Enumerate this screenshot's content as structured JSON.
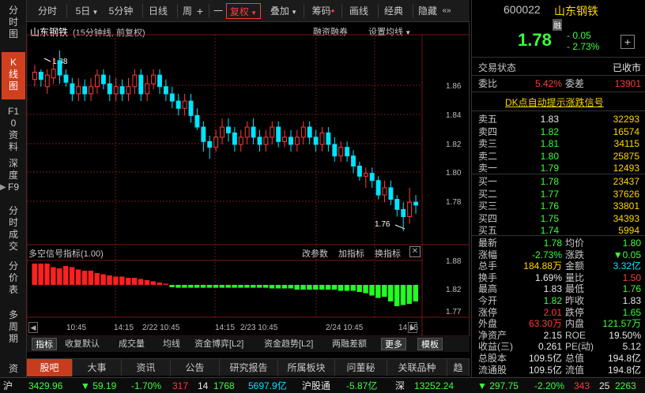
{
  "sidebar": {
    "items": [
      {
        "label": "分时图",
        "active": false
      },
      {
        "label": "K线图",
        "active": true
      },
      {
        "label": "F10资料",
        "active": false
      },
      {
        "label": "深度F9",
        "active": false
      },
      {
        "label": "分时成交",
        "active": false
      },
      {
        "label": "分价表",
        "active": false
      },
      {
        "label": "多周期",
        "active": false
      },
      {
        "label": "资",
        "active": false
      }
    ]
  },
  "toolbar": {
    "fenshi": "分时",
    "five_day": "5日",
    "five_min": "5分钟",
    "day": "日线",
    "week": "周",
    "plus": "+",
    "minus": "一",
    "fuquan": "复权",
    "diejia": "叠加",
    "choumai": "筹码",
    "huaxian": "画线",
    "jingdian": "经典",
    "yincang": "隐藏",
    "more": "«»"
  },
  "chart": {
    "stock_name": "山东钢铁",
    "subtitle": "(15分钟线, 前复权)",
    "rzrq": "融资融券",
    "set_ma": "设置均线",
    "high_label": "1.88",
    "low_label": "1.76",
    "price_ticks": [
      "1.86",
      "1.84",
      "1.82",
      "1.80",
      "1.78"
    ],
    "indicator_title": "多空信号指标",
    "indicator_param": "(1.00)",
    "ind_buttons": {
      "gaicanshu": "改参数",
      "jiazhibiao": "加指标",
      "huanzhibiao": "换指标"
    },
    "ind_ticks": [
      "1.88",
      "1.82",
      "1.77"
    ],
    "time_labels": [
      "10:45",
      "14:15",
      "2/22 10:45",
      "14:15",
      "2/23 10:45",
      "2/24 10:45",
      "14:15"
    ]
  },
  "chart_data": {
    "type": "candlestick",
    "ylim": [
      1.755,
      1.885
    ],
    "candles": [
      [
        1.865,
        1.87,
        1.875,
        1.86
      ],
      [
        1.87,
        1.865,
        1.872,
        1.86
      ],
      [
        1.86,
        1.868,
        1.872,
        1.855
      ],
      [
        1.866,
        1.872,
        1.88,
        1.862
      ],
      [
        1.878,
        1.868,
        1.885,
        1.862
      ],
      [
        1.868,
        1.863,
        1.872,
        1.86
      ],
      [
        1.862,
        1.855,
        1.866,
        1.85
      ],
      [
        1.855,
        1.86,
        1.866,
        1.85
      ],
      [
        1.86,
        1.855,
        1.865,
        1.85
      ],
      [
        1.855,
        1.86,
        1.866,
        1.85
      ],
      [
        1.86,
        1.868,
        1.872,
        1.855
      ],
      [
        1.868,
        1.862,
        1.872,
        1.858
      ],
      [
        1.862,
        1.855,
        1.868,
        1.85
      ],
      [
        1.855,
        1.86,
        1.866,
        1.85
      ],
      [
        1.86,
        1.855,
        1.865,
        1.85
      ],
      [
        1.855,
        1.86,
        1.866,
        1.85
      ],
      [
        1.86,
        1.868,
        1.872,
        1.855
      ],
      [
        1.868,
        1.855,
        1.872,
        1.85
      ],
      [
        1.855,
        1.862,
        1.868,
        1.85
      ],
      [
        1.862,
        1.868,
        1.872,
        1.858
      ],
      [
        1.868,
        1.86,
        1.872,
        1.855
      ],
      [
        1.86,
        1.855,
        1.865,
        1.85
      ],
      [
        1.855,
        1.85,
        1.86,
        1.845
      ],
      [
        1.85,
        1.845,
        1.855,
        1.84
      ],
      [
        1.845,
        1.85,
        1.855,
        1.84
      ],
      [
        1.85,
        1.84,
        1.855,
        1.835
      ],
      [
        1.84,
        1.832,
        1.845,
        1.83
      ],
      [
        1.832,
        1.822,
        1.836,
        1.815
      ],
      [
        1.822,
        1.818,
        1.826,
        1.81
      ],
      [
        1.818,
        1.825,
        1.83,
        1.815
      ],
      [
        1.825,
        1.832,
        1.838,
        1.82
      ],
      [
        1.832,
        1.828,
        1.838,
        1.822
      ],
      [
        1.828,
        1.82,
        1.832,
        1.815
      ],
      [
        1.82,
        1.825,
        1.83,
        1.815
      ],
      [
        1.825,
        1.832,
        1.836,
        1.82
      ],
      [
        1.832,
        1.825,
        1.838,
        1.82
      ],
      [
        1.825,
        1.82,
        1.83,
        1.815
      ],
      [
        1.82,
        1.825,
        1.83,
        1.815
      ],
      [
        1.825,
        1.832,
        1.836,
        1.82
      ],
      [
        1.832,
        1.822,
        1.836,
        1.818
      ],
      [
        1.822,
        1.825,
        1.83,
        1.818
      ],
      [
        1.825,
        1.82,
        1.83,
        1.815
      ],
      [
        1.82,
        1.825,
        1.83,
        1.815
      ],
      [
        1.825,
        1.832,
        1.836,
        1.82
      ],
      [
        1.832,
        1.825,
        1.836,
        1.82
      ],
      [
        1.825,
        1.82,
        1.83,
        1.815
      ],
      [
        1.82,
        1.828,
        1.832,
        1.815
      ],
      [
        1.828,
        1.82,
        1.832,
        1.815
      ],
      [
        1.82,
        1.812,
        1.825,
        1.808
      ],
      [
        1.812,
        1.818,
        1.822,
        1.808
      ],
      [
        1.818,
        1.812,
        1.822,
        1.808
      ],
      [
        1.812,
        1.805,
        1.816,
        1.8
      ],
      [
        1.805,
        1.798,
        1.808,
        1.795
      ],
      [
        1.798,
        1.8,
        1.804,
        1.79
      ],
      [
        1.8,
        1.795,
        1.804,
        1.79
      ],
      [
        1.795,
        1.785,
        1.798,
        1.782
      ],
      [
        1.785,
        1.79,
        1.795,
        1.78
      ],
      [
        1.79,
        1.782,
        1.795,
        1.778
      ],
      [
        1.782,
        1.775,
        1.785,
        1.77
      ],
      [
        1.775,
        1.77,
        1.78,
        1.76
      ],
      [
        1.77,
        1.78,
        1.79,
        1.765
      ],
      [
        1.78,
        1.778,
        1.785,
        1.772
      ]
    ],
    "indicator": [
      0.9,
      0.9,
      0.9,
      0.75,
      0.7,
      0.8,
      0.75,
      0.65,
      0.6,
      0.6,
      0.5,
      0.45,
      0.4,
      0.35,
      0.35,
      0.3,
      0.3,
      0.25,
      0.2,
      0.15,
      0.1,
      0.05,
      -0.1,
      -0.12,
      -0.12,
      -0.12,
      -0.12,
      -0.12,
      -0.12,
      -0.12,
      -0.12,
      -0.12,
      -0.12,
      -0.12,
      -0.12,
      -0.12,
      -0.12,
      -0.12,
      -0.15,
      -0.15,
      -0.15,
      -0.15,
      -0.2,
      -0.2,
      -0.2,
      -0.2,
      -0.2,
      -0.2,
      -0.2,
      -0.25,
      -0.25,
      -0.25,
      -0.3,
      -0.35,
      -0.45,
      -0.55,
      -0.5,
      -0.7,
      -0.9,
      -0.85,
      -0.8,
      -0.7
    ]
  },
  "ind_tabs": [
    "指标",
    "收复默认",
    "成交量",
    "均线",
    "资金博弈[L2]",
    "资金趋势[L2]",
    "两融差额",
    "更多",
    "模板"
  ],
  "nav_tabs": [
    "股吧",
    "大事",
    "资讯",
    "公告",
    "研究报告",
    "所属板块",
    "问董秘",
    "关联品种",
    "趋"
  ],
  "quote": {
    "code": "600022",
    "name": "山东钢铁",
    "rong": "融",
    "price": "1.78",
    "change": "- 0.05",
    "change_pct": "- 2.73%",
    "plus": "+",
    "status_label": "交易状态",
    "status_value": "已收市",
    "weibi_label": "委比",
    "weibi_value": "5.42%",
    "weicha_label": "委差",
    "weicha_value": "13901",
    "signal_link": "DK点自动提示涨跌信号",
    "asks": [
      {
        "label": "卖五",
        "price": "1.83",
        "vol": "32293"
      },
      {
        "label": "卖四",
        "price": "1.82",
        "vol": "16574"
      },
      {
        "label": "卖三",
        "price": "1.81",
        "vol": "34115"
      },
      {
        "label": "卖二",
        "price": "1.80",
        "vol": "25875"
      },
      {
        "label": "卖一",
        "price": "1.79",
        "vol": "12493"
      }
    ],
    "bids": [
      {
        "label": "买一",
        "price": "1.78",
        "vol": "23437"
      },
      {
        "label": "买二",
        "price": "1.77",
        "vol": "37626"
      },
      {
        "label": "买三",
        "price": "1.76",
        "vol": "33801"
      },
      {
        "label": "买四",
        "price": "1.75",
        "vol": "34393"
      },
      {
        "label": "买五",
        "price": "1.74",
        "vol": "5994"
      }
    ],
    "stats": [
      {
        "l1": "最新",
        "v1": "1.78",
        "c1": "green",
        "l2": "均价",
        "v2": "1.80",
        "c2": "green"
      },
      {
        "l1": "涨幅",
        "v1": "-2.73%",
        "c1": "green",
        "l2": "涨跌",
        "v2": "▼0.05",
        "c2": "green"
      },
      {
        "l1": "总手",
        "v1": "184.88万",
        "c1": "yellow",
        "l2": "金额",
        "v2": "3.32亿",
        "c2": "cyan"
      },
      {
        "l1": "换手",
        "v1": "1.69%",
        "c1": "white",
        "l2": "量比",
        "v2": "1.50",
        "c2": "red"
      },
      {
        "l1": "最高",
        "v1": "1.83",
        "c1": "white",
        "l2": "最低",
        "v2": "1.76",
        "c2": "green"
      },
      {
        "l1": "今开",
        "v1": "1.82",
        "c1": "green",
        "l2": "昨收",
        "v2": "1.83",
        "c2": "white"
      },
      {
        "l1": "涨停",
        "v1": "2.01",
        "c1": "red",
        "l2": "跌停",
        "v2": "1.65",
        "c2": "green"
      },
      {
        "l1": "外盘",
        "v1": "63.30万",
        "c1": "red",
        "l2": "内盘",
        "v2": "121.57万",
        "c2": "green"
      },
      {
        "l1": "净资产",
        "v1": "2.15",
        "c1": "white",
        "l2": "ROE",
        "v2": "19.50%",
        "c2": "white"
      },
      {
        "l1": "收益(三)",
        "v1": "0.261",
        "c1": "white",
        "l2": "PE(动)",
        "v2": "5.12",
        "c2": "white"
      },
      {
        "l1": "总股本",
        "v1": "109.5亿",
        "c1": "white",
        "l2": "总值",
        "v2": "194.8亿",
        "c2": "white"
      },
      {
        "l1": "流通股",
        "v1": "109.5亿",
        "c1": "white",
        "l2": "流值",
        "v2": "194.8亿",
        "c2": "white"
      }
    ]
  },
  "statusbar": {
    "sh_label": "沪",
    "sh_index": "3429.96",
    "sh_change": "▼ 59.19",
    "sh_pct": "-1.70%",
    "sh_up": "317",
    "sh_flat": "14",
    "sh_down": "1768",
    "sh_amount": "5697.9亿",
    "hgt_label": "沪股通",
    "hgt_value": "-5.87亿",
    "sz_label": "深",
    "sz_index": "13252.24",
    "sz_change": "▼ 297.75",
    "sz_pct": "-2.20%",
    "sz_up": "343",
    "sz_flat": "25",
    "sz_down": "2263"
  }
}
